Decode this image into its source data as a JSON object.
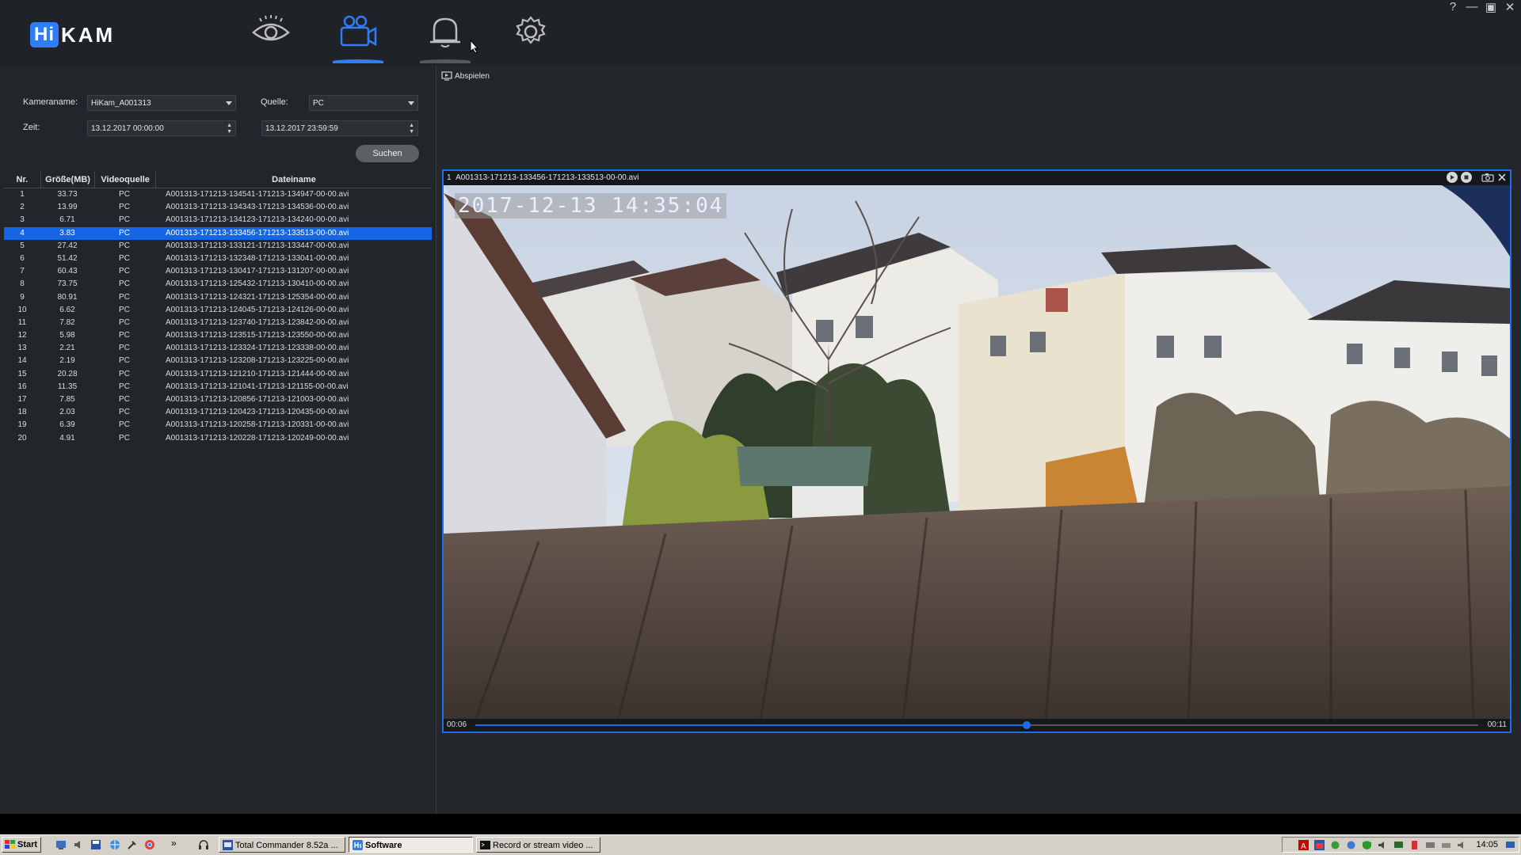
{
  "app": {
    "logo_hi": "Hi",
    "logo_kam": "KAM",
    "window_controls": [
      "?",
      "—",
      "▣",
      "✕"
    ]
  },
  "nav": [
    {
      "name": "live-view",
      "icon": "eye-icon",
      "active": false
    },
    {
      "name": "playback",
      "icon": "video-camera-icon",
      "active": true
    },
    {
      "name": "alarm",
      "icon": "bell-icon",
      "active": false
    },
    {
      "name": "settings",
      "icon": "gear-icon",
      "active": false
    }
  ],
  "search": {
    "camera_label": "Kameraname:",
    "camera_value": "HiKam_A001313",
    "source_label": "Quelle:",
    "source_value": "PC",
    "time_label": "Zeit:",
    "time_from": "13.12.2017 00:00:00",
    "time_to": "13.12.2017 23:59:59",
    "search_button": "Suchen"
  },
  "table": {
    "headers": [
      "Nr.",
      "Größe(MB)",
      "Videoquelle",
      "Dateiname"
    ],
    "selected_index": 3,
    "rows": [
      [
        "1",
        "33.73",
        "PC",
        "A001313-171213-134541-171213-134947-00-00.avi"
      ],
      [
        "2",
        "13.99",
        "PC",
        "A001313-171213-134343-171213-134536-00-00.avi"
      ],
      [
        "3",
        "6.71",
        "PC",
        "A001313-171213-134123-171213-134240-00-00.avi"
      ],
      [
        "4",
        "3.83",
        "PC",
        "A001313-171213-133456-171213-133513-00-00.avi"
      ],
      [
        "5",
        "27.42",
        "PC",
        "A001313-171213-133121-171213-133447-00-00.avi"
      ],
      [
        "6",
        "51.42",
        "PC",
        "A001313-171213-132348-171213-133041-00-00.avi"
      ],
      [
        "7",
        "60.43",
        "PC",
        "A001313-171213-130417-171213-131207-00-00.avi"
      ],
      [
        "8",
        "73.75",
        "PC",
        "A001313-171213-125432-171213-130410-00-00.avi"
      ],
      [
        "9",
        "80.91",
        "PC",
        "A001313-171213-124321-171213-125354-00-00.avi"
      ],
      [
        "10",
        "6.62",
        "PC",
        "A001313-171213-124045-171213-124126-00-00.avi"
      ],
      [
        "11",
        "7.82",
        "PC",
        "A001313-171213-123740-171213-123842-00-00.avi"
      ],
      [
        "12",
        "5.98",
        "PC",
        "A001313-171213-123515-171213-123550-00-00.avi"
      ],
      [
        "13",
        "2.21",
        "PC",
        "A001313-171213-123324-171213-123338-00-00.avi"
      ],
      [
        "14",
        "2.19",
        "PC",
        "A001313-171213-123208-171213-123225-00-00.avi"
      ],
      [
        "15",
        "20.28",
        "PC",
        "A001313-171213-121210-171213-121444-00-00.avi"
      ],
      [
        "16",
        "11.35",
        "PC",
        "A001313-171213-121041-171213-121155-00-00.avi"
      ],
      [
        "17",
        "7.85",
        "PC",
        "A001313-171213-120856-171213-121003-00-00.avi"
      ],
      [
        "18",
        "2.03",
        "PC",
        "A001313-171213-120423-171213-120435-00-00.avi"
      ],
      [
        "19",
        "6.39",
        "PC",
        "A001313-171213-120258-171213-120331-00-00.avi"
      ],
      [
        "20",
        "4.91",
        "PC",
        "A001313-171213-120228-171213-120249-00-00.avi"
      ]
    ]
  },
  "player": {
    "tab_label": "Abspielen",
    "channel": "1",
    "file_title": "A001313-171213-133456-171213-133513-00-00.avi",
    "osd_timestamp": "2017-12-13 14:35:04",
    "time_current": "00:06",
    "time_total": "00:11",
    "progress_fraction": 0.55
  },
  "taskbar": {
    "start_label": "Start",
    "more_label": "»",
    "tasks": [
      {
        "label": "Total Commander 8.52a ...",
        "active": false
      },
      {
        "label": "Software",
        "active": true
      },
      {
        "label": "Record or stream video ...",
        "active": false
      }
    ],
    "clock": "14:05"
  },
  "colors": {
    "accent": "#1e6cf0",
    "selection": "#1466e6",
    "background": "#23262a"
  }
}
